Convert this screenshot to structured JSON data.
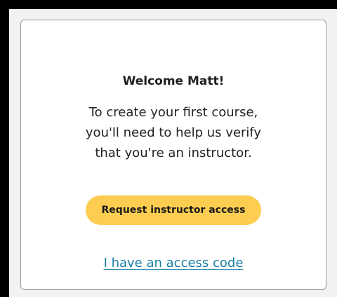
{
  "welcome": {
    "title": "Welcome Matt!",
    "message_lines": [
      "To create your first course,",
      "you'll need to help us verify",
      "that you're an instructor."
    ],
    "request_button_label": "Request instructor access",
    "access_code_link_label": "I have an access code"
  },
  "colors": {
    "button_background": "#fccd50",
    "link": "#1a7fa6",
    "card_border": "#9a9a9a",
    "page_border": "#000000"
  }
}
